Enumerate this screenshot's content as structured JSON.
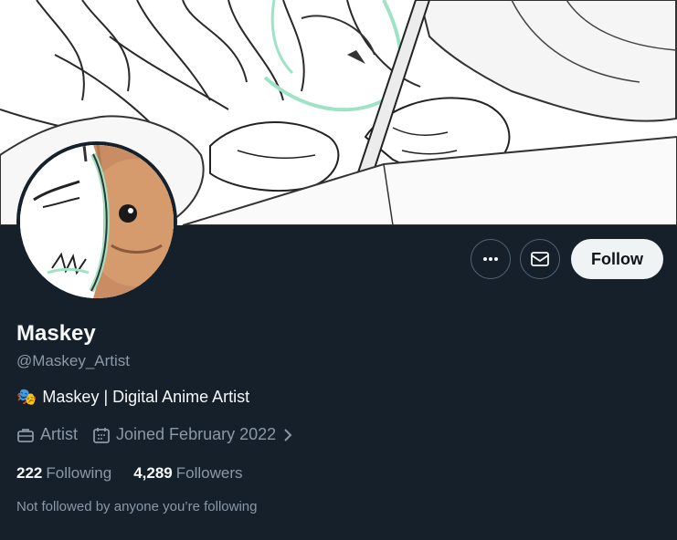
{
  "profile": {
    "display_name": "Maskey",
    "handle": "@Maskey_Artist",
    "bio_emoji": "🎭",
    "bio": "Maskey | Digital Anime Artist",
    "profession": "Artist",
    "joined": "Joined February 2022",
    "following_count": "222",
    "following_label": "Following",
    "followers_count": "4,289",
    "followers_label": "Followers",
    "not_followed_text": "Not followed by anyone you’re following"
  },
  "actions": {
    "more_icon": "more-horizontal-icon",
    "message_icon": "envelope-icon",
    "follow_label": "Follow"
  },
  "icons": {
    "profession": "briefcase-icon",
    "joined": "calendar-icon",
    "joined_chevron": "chevron-right-icon"
  },
  "colors": {
    "background": "#15202b",
    "text_primary": "#f7f9f9",
    "text_secondary": "#8b98a5",
    "follow_button_bg": "#eff3f4",
    "button_border": "#536471"
  }
}
